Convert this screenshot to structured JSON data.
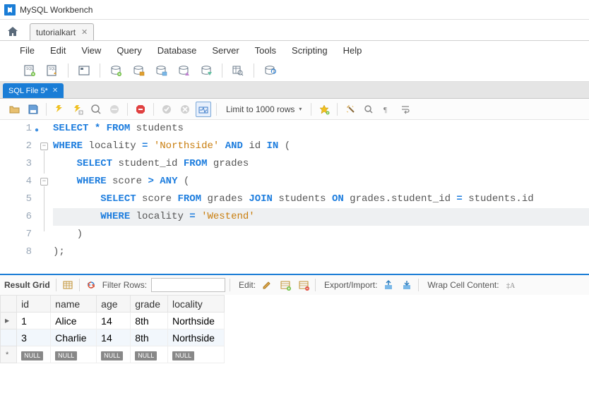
{
  "titlebar": {
    "title": "MySQL Workbench"
  },
  "tabs": {
    "home_tab": "tutorialkart"
  },
  "menu": [
    "File",
    "Edit",
    "View",
    "Query",
    "Database",
    "Server",
    "Tools",
    "Scripting",
    "Help"
  ],
  "sql_tab": {
    "label": "SQL File 5*"
  },
  "editor_toolbar": {
    "limit": "Limit to 1000 rows"
  },
  "sql": {
    "tokens": {
      "ln1": {
        "select": "SELECT",
        "star": "*",
        "from": "FROM",
        "students": "students"
      },
      "ln2": {
        "where": "WHERE",
        "locality": "locality",
        "eq": "=",
        "str": "'Northside'",
        "and": "AND",
        "id": "id",
        "in": "IN",
        "open": "("
      },
      "ln3": {
        "select": "SELECT",
        "sid": "student_id",
        "from": "FROM",
        "grades": "grades"
      },
      "ln4": {
        "where": "WHERE",
        "score": "score",
        "gt": ">",
        "any": "ANY",
        "open": "("
      },
      "ln5": {
        "select": "SELECT",
        "score": "score",
        "from": "FROM",
        "grades": "grades",
        "join": "JOIN",
        "students": "students",
        "on": "ON",
        "gsid": "grades.student_id",
        "eq": "=",
        "sid": "students.id"
      },
      "ln6": {
        "where": "WHERE",
        "locality": "locality",
        "eq": "=",
        "str": "'Westend'"
      },
      "ln7": {
        "close": ")"
      },
      "ln8": {
        "close_semi": ");"
      }
    }
  },
  "result_bar": {
    "label": "Result Grid",
    "filter_label": "Filter Rows:",
    "edit_label": "Edit:",
    "export_label": "Export/Import:",
    "wrap_label": "Wrap Cell Content:"
  },
  "grid": {
    "headers": [
      "id",
      "name",
      "age",
      "grade",
      "locality"
    ],
    "rows": [
      {
        "id": "1",
        "name": "Alice",
        "age": "14",
        "grade": "8th",
        "locality": "Northside"
      },
      {
        "id": "3",
        "name": "Charlie",
        "age": "14",
        "grade": "8th",
        "locality": "Northside"
      }
    ],
    "null": "NULL"
  }
}
